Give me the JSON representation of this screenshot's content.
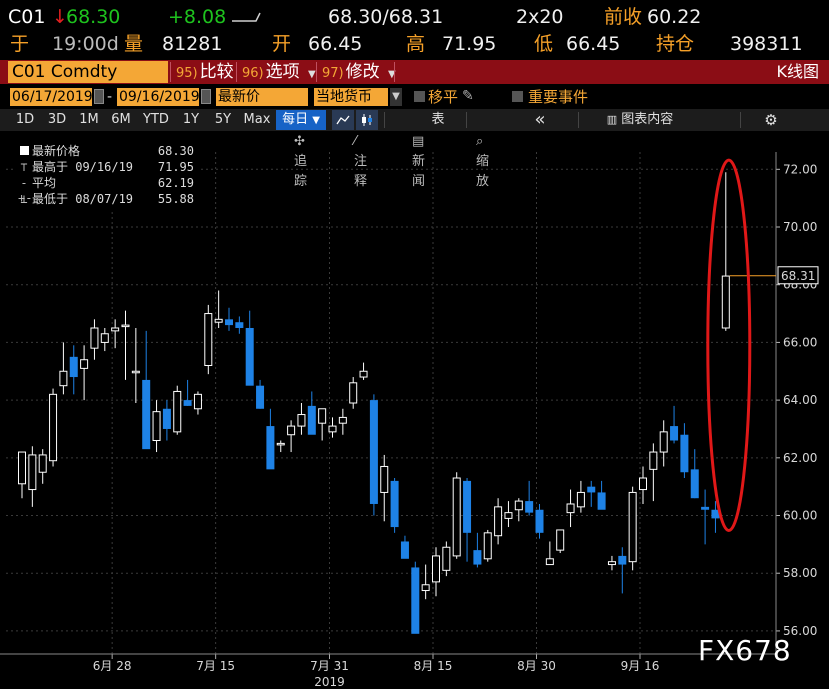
{
  "quote": {
    "ticker": "C01",
    "arrow": "↓",
    "last": "68.30",
    "change": "+8.08",
    "bid_ask": "68.30/68.31",
    "size": "2x20",
    "prev_close_label": "前收",
    "prev_close": "60.22",
    "at_label": "于",
    "time": "19:00d",
    "volume_label": "量",
    "volume": "81281",
    "open_label": "开",
    "open": "66.45",
    "high_label": "高",
    "high": "71.95",
    "low_label": "低",
    "low": "66.45",
    "oi_label": "持仓",
    "oi": "398311"
  },
  "command_bar": {
    "security": "C01 Comdty",
    "compare_num": "95)",
    "compare": "比较",
    "options_num": "96)",
    "options": "选项",
    "edit_num": "97)",
    "edit": "修改",
    "chart_type": "K线图"
  },
  "date_row": {
    "start": "06/17/2019",
    "dash": "-",
    "end": "09/16/2019",
    "field": "最新价",
    "currency": "当地货币",
    "pan": "移平",
    "events": "重要事件"
  },
  "timeframes": {
    "items": [
      "1D",
      "3D",
      "1M",
      "6M",
      "YTD",
      "1Y",
      "5Y",
      "Max"
    ],
    "active": "每日",
    "table": "表",
    "collapse": "«",
    "chart_content": "图表内容",
    "settings_icon": "gear-icon"
  },
  "tools": {
    "track": "追踪",
    "annotate": "注释",
    "news": "新闻",
    "zoom": "缩放"
  },
  "legend": {
    "rows": [
      {
        "label": "最新价格",
        "value": "68.30"
      },
      {
        "label": "最高于 09/16/19",
        "value": "71.95"
      },
      {
        "label": "平均",
        "value": "62.19"
      },
      {
        "label": "最低于 08/07/19",
        "value": "55.88"
      }
    ]
  },
  "watermark": "FX678",
  "colors": {
    "up": "#ffffff",
    "down": "#1e82e6",
    "highlight_ring": "#e01818",
    "price_tag_line": "#f5a028"
  },
  "chart_data": {
    "type": "candlestick",
    "x_ticks": [
      "6月 28",
      "7月 15",
      "7月 31",
      "8月 15",
      "8月 30",
      "9月 16"
    ],
    "x_tick_index": [
      9,
      19,
      30,
      40,
      50,
      60
    ],
    "year_label": "2019",
    "year_label_index": 30,
    "y_ticks": [
      "72.00",
      "70.00",
      "68.00",
      "66.00",
      "64.00",
      "62.00",
      "60.00",
      "58.00",
      "56.00"
    ],
    "y_tick_values": [
      72,
      70,
      68,
      66,
      64,
      62,
      60,
      58,
      56
    ],
    "ylim": [
      55.2,
      72.6
    ],
    "last_price_label": "68.31",
    "last_price": 68.31,
    "ohlc": [
      [
        61.1,
        62.2,
        60.6,
        62.2
      ],
      [
        60.9,
        62.4,
        60.3,
        62.1
      ],
      [
        61.5,
        62.3,
        61.1,
        62.1
      ],
      [
        61.9,
        64.4,
        61.7,
        64.2
      ],
      [
        64.5,
        66.0,
        64.2,
        65.0
      ],
      [
        65.5,
        65.9,
        64.2,
        64.8
      ],
      [
        65.1,
        65.9,
        64.0,
        65.4
      ],
      [
        65.8,
        66.8,
        65.4,
        66.5
      ],
      [
        66.0,
        66.5,
        65.7,
        66.3
      ],
      [
        66.4,
        66.8,
        65.8,
        66.5
      ],
      [
        66.6,
        67.1,
        64.7,
        66.6
      ],
      [
        65.0,
        66.5,
        63.9,
        65.0
      ],
      [
        64.7,
        66.4,
        62.4,
        62.3
      ],
      [
        62.6,
        64.0,
        62.2,
        63.6
      ],
      [
        63.7,
        64.0,
        62.6,
        63.0
      ],
      [
        62.9,
        64.5,
        62.8,
        64.3
      ],
      [
        64.0,
        64.7,
        63.8,
        63.8
      ],
      [
        63.7,
        64.3,
        63.5,
        64.2
      ],
      [
        65.2,
        67.3,
        64.9,
        67.0
      ],
      [
        66.7,
        67.8,
        66.5,
        66.8
      ],
      [
        66.8,
        67.2,
        66.4,
        66.6
      ],
      [
        66.7,
        66.9,
        66.3,
        66.5
      ],
      [
        66.5,
        67.1,
        65.6,
        64.5
      ],
      [
        64.5,
        64.7,
        63.7,
        63.7
      ],
      [
        63.1,
        63.7,
        62.0,
        61.6
      ],
      [
        62.5,
        62.6,
        62.2,
        62.5
      ],
      [
        62.8,
        63.3,
        62.2,
        63.1
      ],
      [
        63.1,
        63.9,
        62.8,
        63.5
      ],
      [
        63.8,
        64.3,
        63.3,
        62.8
      ],
      [
        63.2,
        63.6,
        62.6,
        63.7
      ],
      [
        62.9,
        63.4,
        62.7,
        63.1
      ],
      [
        63.2,
        63.7,
        62.8,
        63.4
      ],
      [
        63.9,
        64.8,
        63.7,
        64.6
      ],
      [
        64.8,
        65.3,
        64.7,
        65.0
      ],
      [
        64.0,
        64.2,
        60.0,
        60.4
      ],
      [
        60.8,
        62.1,
        59.8,
        61.7
      ],
      [
        61.2,
        61.3,
        59.4,
        59.6
      ],
      [
        59.1,
        59.3,
        58.7,
        58.5
      ],
      [
        58.2,
        58.4,
        56.0,
        55.9
      ],
      [
        57.4,
        58.3,
        57.1,
        57.6
      ],
      [
        57.7,
        58.9,
        57.2,
        58.6
      ],
      [
        58.1,
        59.1,
        57.9,
        58.9
      ],
      [
        58.6,
        61.5,
        58.5,
        61.3
      ],
      [
        61.2,
        61.3,
        58.4,
        59.4
      ],
      [
        58.8,
        59.4,
        58.2,
        58.3
      ],
      [
        58.5,
        59.5,
        58.4,
        59.4
      ],
      [
        59.3,
        60.6,
        59.0,
        60.3
      ],
      [
        59.9,
        60.5,
        59.6,
        60.1
      ],
      [
        60.2,
        60.6,
        59.8,
        60.5
      ],
      [
        60.5,
        61.2,
        60.0,
        60.1
      ],
      [
        60.2,
        60.4,
        59.2,
        59.4
      ],
      [
        58.3,
        59.1,
        58.4,
        58.5
      ],
      [
        58.8,
        59.2,
        58.7,
        59.5
      ],
      [
        60.1,
        60.9,
        59.6,
        60.4
      ],
      [
        60.3,
        61.2,
        60.1,
        60.8
      ],
      [
        61.0,
        61.2,
        60.3,
        60.8
      ],
      [
        60.8,
        61.2,
        60.4,
        60.2
      ],
      [
        58.3,
        58.6,
        58.1,
        58.4
      ],
      [
        58.6,
        58.9,
        57.3,
        58.3
      ],
      [
        58.4,
        61.0,
        58.1,
        60.8
      ],
      [
        60.9,
        61.7,
        60.4,
        61.3
      ],
      [
        61.6,
        62.5,
        60.5,
        62.2
      ],
      [
        62.2,
        63.3,
        61.7,
        62.9
      ],
      [
        63.1,
        63.8,
        62.5,
        62.6
      ],
      [
        62.8,
        63.2,
        61.3,
        61.5
      ],
      [
        61.6,
        62.3,
        60.6,
        60.6
      ],
      [
        60.3,
        60.9,
        59.0,
        60.2
      ],
      [
        60.2,
        60.5,
        59.4,
        59.9
      ],
      [
        66.5,
        71.9,
        66.4,
        68.3
      ]
    ]
  }
}
